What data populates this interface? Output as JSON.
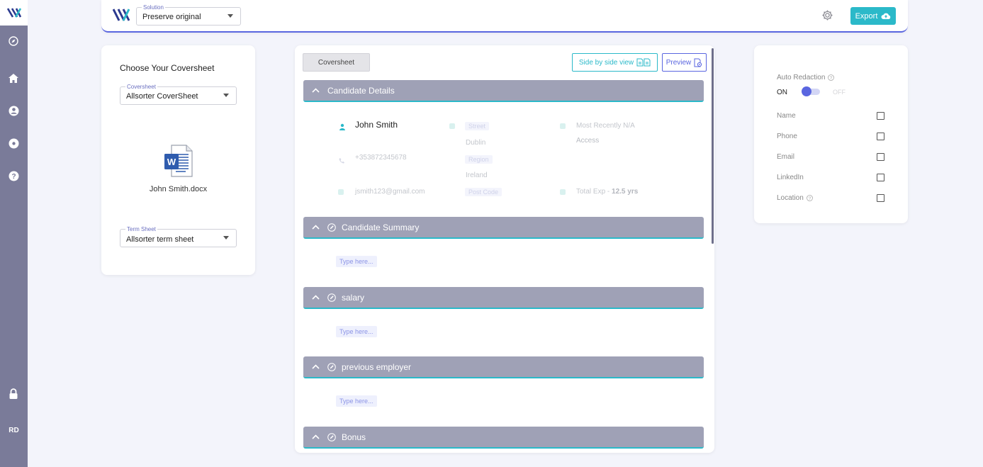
{
  "rail": {
    "initials": "RD"
  },
  "topbar": {
    "solution_legend": "Solution",
    "solution_value": "Preserve original",
    "export_label": "Export"
  },
  "coversheet_panel": {
    "title": "Choose Your Coversheet",
    "coversheet_legend": "Coversheet",
    "coversheet_value": "Allsorter CoverSheet",
    "document_name": "John Smith.docx",
    "termsheet_legend": "Term Sheet",
    "termsheet_value": "Allsorter term sheet"
  },
  "editor": {
    "tab_label": "Coversheet",
    "side_by_side_label": "Side by side view",
    "preview_label": "Preview",
    "candidate": {
      "header": "Candidate Details",
      "name": "John Smith",
      "phone": "+353872345678",
      "email": "jsmith123@gmail.com",
      "street_label": "Street",
      "city": "Dublin",
      "region_label": "Region",
      "country": "Ireland",
      "postcode_label": "Post Code",
      "recent": "Most Recently N/A",
      "access": "Access",
      "total_exp_prefix": "Total Exp - ",
      "total_exp_value": "12.5 yrs"
    },
    "sections": [
      {
        "title": "Candidate Summary",
        "placeholder": "Type here..."
      },
      {
        "title": "salary",
        "placeholder": "Type here..."
      },
      {
        "title": "previous employer",
        "placeholder": "Type here..."
      },
      {
        "title": "Bonus",
        "placeholder": ""
      }
    ]
  },
  "redaction": {
    "title": "Auto Redaction",
    "on_label": "ON",
    "off_label": "OFF",
    "enabled": true,
    "options": [
      {
        "label": "Name",
        "checked": false
      },
      {
        "label": "Phone",
        "checked": false
      },
      {
        "label": "Email",
        "checked": false
      },
      {
        "label": "LinkedIn",
        "checked": false
      },
      {
        "label": "Location",
        "checked": false
      }
    ]
  },
  "colors": {
    "accent": "#5a66e0",
    "teal": "#2bb9c9",
    "rail": "#7a7b99",
    "section": "#9fa1b6"
  }
}
